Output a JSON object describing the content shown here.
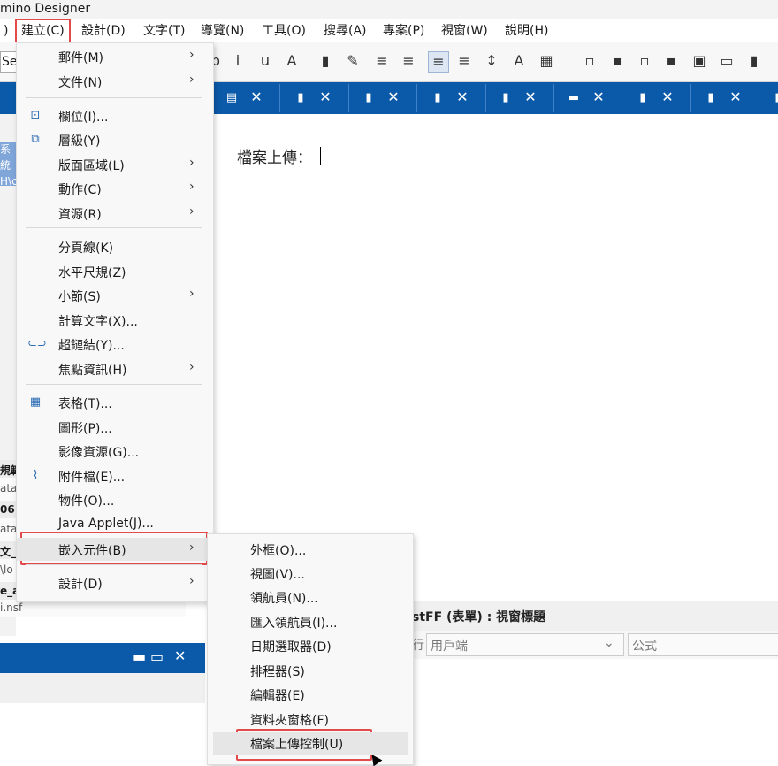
{
  "window": {
    "title": "mino Designer"
  },
  "menubar": {
    "items": [
      "建立(C)",
      "設計(D)",
      "文字(T)",
      "導覽(N)",
      "工具(O)",
      "搜尋(A)",
      "專案(P)",
      "視窗(W)",
      "說明(H)"
    ],
    "partial_left": ")",
    "active_index": 0
  },
  "toolbar": {
    "combo_text": "Se",
    "icons": [
      "bold-b-icon",
      "italic-i-icon",
      "underline-u-icon",
      "text-color-a-icon",
      "highlight-icon",
      "pen-icon",
      "align-center-icon",
      "align-justify-icon",
      "align-left-icon",
      "align-right-icon",
      "line-spacing-icon",
      "text-style-icon",
      "table-icon",
      "field-icon",
      "layer-icon",
      "insert-icon",
      "view-icon",
      "form-icon",
      "frame-icon",
      "layout-icon"
    ],
    "glyphs": [
      "b",
      "i",
      "u",
      "A",
      "▮",
      "✎",
      "≡",
      "≡",
      "≡",
      "≡",
      "↕",
      "A",
      "▦",
      "▫",
      "▪",
      "▫",
      "▪",
      "▣",
      "▭",
      "▮"
    ],
    "selected_index": 8
  },
  "tabs": {
    "icons": [
      "form-tab-icon",
      "page-tab-icon",
      "view-tab-icon",
      "page-tab-icon",
      "page-tab-icon",
      "subform-tab-icon",
      "page-tab-icon",
      "doc-tab-icon",
      "agent-tab-icon"
    ],
    "glyphs": [
      "▤",
      "▮",
      "▮",
      "▮",
      "▮",
      "▬",
      "▮",
      "▮",
      "▮"
    ],
    "close_glyph": "✕"
  },
  "left_panel": {
    "selected_line1": "系統",
    "selected_line2": "H\\c",
    "lines": [
      "規範",
      "ata",
      "06",
      "ata",
      "文_",
      "\\lo",
      "e_a",
      "i.nsf"
    ]
  },
  "editor": {
    "field_label": "檔案上傳："
  },
  "bottom_right": {
    "header": "stFF (表單) : 視窗標題",
    "partial_label": "行",
    "combo_value": "用戶端",
    "formula_label": "公式"
  },
  "bottom_left": {
    "controls": [
      "▬",
      "▭",
      "✕"
    ]
  },
  "create_menu": {
    "items": [
      {
        "label": "郵件(M)",
        "submenu": true,
        "icon": ""
      },
      {
        "label": "文件(N)",
        "submenu": true,
        "icon": ""
      },
      {
        "label": "欄位(I)...",
        "submenu": false,
        "icon": "field-icon"
      },
      {
        "label": "層級(Y)",
        "submenu": false,
        "icon": "layer-icon"
      },
      {
        "label": "版面區域(L)",
        "submenu": true,
        "icon": ""
      },
      {
        "label": "動作(C)",
        "submenu": true,
        "icon": ""
      },
      {
        "label": "資源(R)",
        "submenu": true,
        "icon": ""
      },
      {
        "label": "分頁線(K)",
        "submenu": false,
        "icon": ""
      },
      {
        "label": "水平尺規(Z)",
        "submenu": false,
        "icon": ""
      },
      {
        "label": "小節(S)",
        "submenu": true,
        "icon": ""
      },
      {
        "label": "計算文字(X)...",
        "submenu": false,
        "icon": ""
      },
      {
        "label": "超鏈結(Y)...",
        "submenu": false,
        "icon": "link-icon"
      },
      {
        "label": "焦點資訊(H)",
        "submenu": true,
        "icon": ""
      },
      {
        "label": "表格(T)...",
        "submenu": false,
        "icon": "table-icon"
      },
      {
        "label": "圖形(P)...",
        "submenu": false,
        "icon": ""
      },
      {
        "label": "影像資源(G)...",
        "submenu": false,
        "icon": ""
      },
      {
        "label": "附件檔(E)...",
        "submenu": false,
        "icon": "paperclip-icon"
      },
      {
        "label": "物件(O)...",
        "submenu": false,
        "icon": ""
      },
      {
        "label": "Java Applet(J)...",
        "submenu": false,
        "icon": ""
      },
      {
        "label": "嵌入元件(B)",
        "submenu": true,
        "icon": ""
      },
      {
        "label": "設計(D)",
        "submenu": true,
        "icon": ""
      }
    ],
    "icon_glyphs": {
      "field-icon": "⊡",
      "layer-icon": "⧉",
      "link-icon": "⊂⊃",
      "table-icon": "▦",
      "paperclip-icon": "⌇"
    },
    "arrow": "›"
  },
  "embed_submenu": {
    "items": [
      "外框(O)...",
      "視圖(V)...",
      "領航員(N)...",
      "匯入領航員(I)...",
      "日期選取器(D)",
      "排程器(S)",
      "編輯器(E)",
      "資料夾窗格(F)",
      "檔案上傳控制(U)"
    ]
  }
}
